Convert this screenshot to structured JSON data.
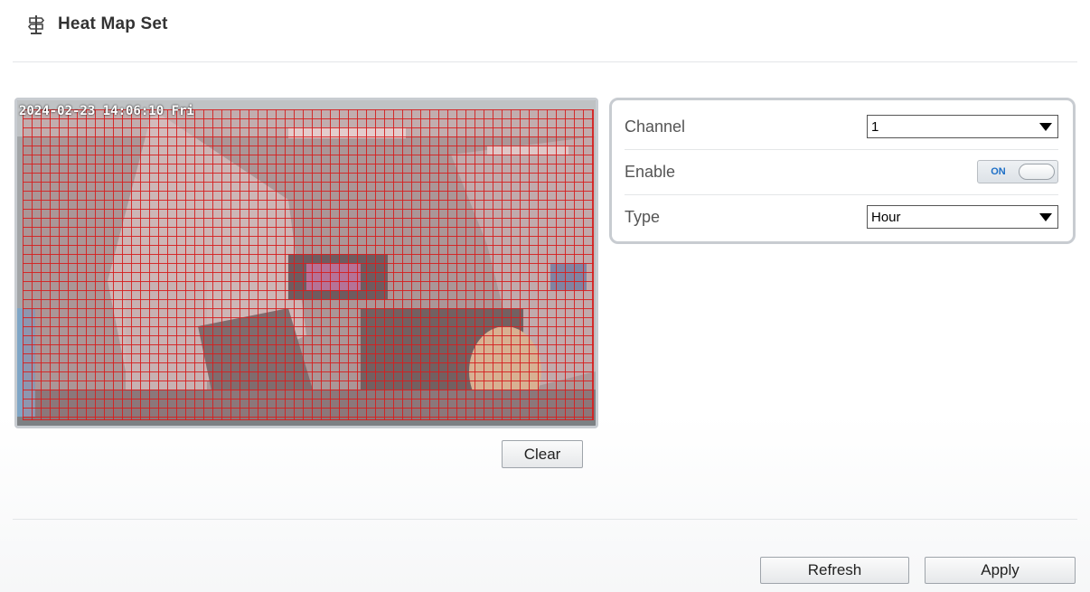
{
  "header": {
    "title": "Heat Map Set",
    "icon": "signpost-icon"
  },
  "video": {
    "osd_timestamp": "2024-02-23 14:06:10 Fri"
  },
  "actions": {
    "clear_label": "Clear",
    "refresh_label": "Refresh",
    "apply_label": "Apply"
  },
  "settings": {
    "channel": {
      "label": "Channel",
      "value": "1"
    },
    "enable": {
      "label": "Enable",
      "state_label": "ON"
    },
    "type": {
      "label": "Type",
      "value": "Hour"
    }
  },
  "colors": {
    "grid": "#d61e1e",
    "toggle_text": "#1d6fc7",
    "panel_border": "#c8ccd1"
  }
}
